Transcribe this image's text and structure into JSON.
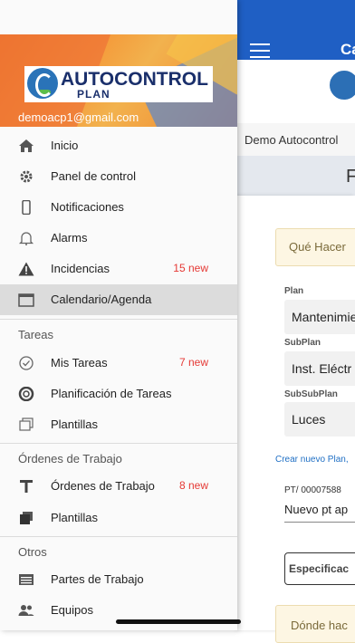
{
  "app": {
    "title": "Ca",
    "company": "Demo Autocontrol",
    "page_heading": "F",
    "que_hacer": "Qué Hacer",
    "fields": [
      {
        "label": "Plan",
        "value": "Mantenimie"
      },
      {
        "label": "SubPlan",
        "value": "Inst. Eléctr"
      },
      {
        "label": "SubSubPlan",
        "value": "Luces"
      }
    ],
    "create_link": "Crear nuevo Plan,",
    "pt_label": "PT/ 00007588",
    "pt_value": "Nuevo pt ap",
    "spec_button": "Especificac",
    "donde": "Dónde hac"
  },
  "drawer": {
    "brand": "AUTOCONTROL",
    "brand_sub": "PLAN",
    "email": "demoacp1@gmail.com",
    "items": [
      {
        "label": "Inicio",
        "icon": "home-icon",
        "badge": ""
      },
      {
        "label": "Panel de control",
        "icon": "gear-icon",
        "badge": ""
      },
      {
        "label": "Notificaciones",
        "icon": "phone-icon",
        "badge": ""
      },
      {
        "label": "Alarms",
        "icon": "bell-icon",
        "badge": ""
      },
      {
        "label": "Incidencias",
        "icon": "warning-icon",
        "badge": "15 new"
      },
      {
        "label": "Calendario/Agenda",
        "icon": "calendar-icon",
        "badge": ""
      }
    ],
    "sections": [
      {
        "title": "Tareas",
        "items": [
          {
            "label": "Mis Tareas",
            "icon": "check-circle-icon",
            "badge": "7 new"
          },
          {
            "label": "Planificación de Tareas",
            "icon": "lifebuoy-icon",
            "badge": ""
          },
          {
            "label": "Plantillas",
            "icon": "copy-icon",
            "badge": ""
          }
        ]
      },
      {
        "title": "Órdenes de Trabajo",
        "items": [
          {
            "label": "Órdenes de Trabajo",
            "icon": "tool-icon",
            "badge": "8 new"
          },
          {
            "label": "Plantillas",
            "icon": "layers-icon",
            "badge": ""
          }
        ]
      },
      {
        "title": "Otros",
        "items": [
          {
            "label": "Partes de Trabajo",
            "icon": "list-icon",
            "badge": ""
          },
          {
            "label": "Equipos",
            "icon": "people-icon",
            "badge": ""
          }
        ]
      }
    ]
  },
  "colors": {
    "primary": "#1f5fc4",
    "badge": "#e53935",
    "active_bg": "#dcdcdc"
  }
}
